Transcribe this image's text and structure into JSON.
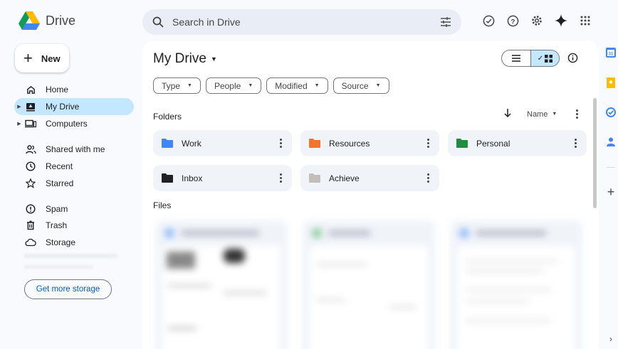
{
  "app": {
    "name": "Drive"
  },
  "search": {
    "placeholder": "Search in Drive"
  },
  "sidebar": {
    "new_label": "New",
    "items": [
      {
        "label": "Home",
        "icon": "home-icon"
      },
      {
        "label": "My Drive",
        "icon": "my-drive-icon",
        "active": true
      },
      {
        "label": "Computers",
        "icon": "computers-icon"
      },
      {
        "label": "Shared with me",
        "icon": "shared-icon"
      },
      {
        "label": "Recent",
        "icon": "clock-icon"
      },
      {
        "label": "Starred",
        "icon": "star-icon"
      },
      {
        "label": "Spam",
        "icon": "spam-icon"
      },
      {
        "label": "Trash",
        "icon": "trash-icon"
      },
      {
        "label": "Storage",
        "icon": "cloud-icon"
      }
    ],
    "storage_button": "Get more storage"
  },
  "main": {
    "title": "My Drive",
    "filters": [
      "Type",
      "People",
      "Modified",
      "Source"
    ],
    "folders_heading": "Folders",
    "sort_label": "Name",
    "files_heading": "Files",
    "folders": [
      {
        "name": "Work",
        "color": "#4285f4"
      },
      {
        "name": "Resources",
        "color": "#f4742c"
      },
      {
        "name": "Personal",
        "color": "#1e8e3e"
      },
      {
        "name": "Inbox",
        "color": "#202124"
      },
      {
        "name": "Achieve",
        "color": "#c5bcbc"
      }
    ]
  },
  "colors": {
    "accent": "#0b57d0",
    "active_bg": "#c2e7ff",
    "surface": "#f0f4f9"
  }
}
